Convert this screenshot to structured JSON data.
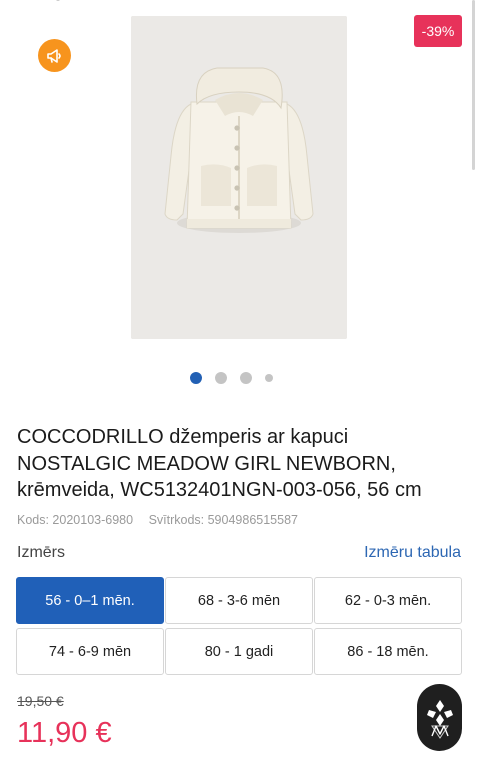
{
  "gallery": {
    "discount_badge": "-39%",
    "promo_icon": "megaphone-icon",
    "image_alt": "cream hooded cardigan",
    "slides": [
      {
        "active": true
      },
      {
        "active": false
      },
      {
        "active": false
      },
      {
        "active": false
      }
    ]
  },
  "product": {
    "title": "COCCODRILLO džemperis ar kapuci NOSTALGIC MEADOW GIRL NEWBORN, krēmveida, WC5132401NGN-003-056, 56 cm",
    "code": "Kods: 2020103-6980",
    "barcode": "Svītrkods: 5904986515587"
  },
  "size_selector": {
    "label": "Izmērs",
    "table_link": "Izmēru tabula",
    "options": [
      {
        "label": "56 - 0–1 mēn.",
        "selected": true
      },
      {
        "label": "68 - 3-6 mēn",
        "selected": false
      },
      {
        "label": "62 - 0-3 mēn.",
        "selected": false
      },
      {
        "label": "74 - 6-9 mēn",
        "selected": false
      },
      {
        "label": "80 - 1 gadi",
        "selected": false
      },
      {
        "label": "86 - 18 mēn.",
        "selected": false
      }
    ]
  },
  "pricing": {
    "old_price": "19,50 €",
    "price": "11,90 €"
  },
  "colors": {
    "accent_blue": "#2060b8",
    "sale_pink": "#e7325a",
    "promo_orange": "#f7941d"
  },
  "fab": {
    "icon": "brand-logo-icon"
  }
}
